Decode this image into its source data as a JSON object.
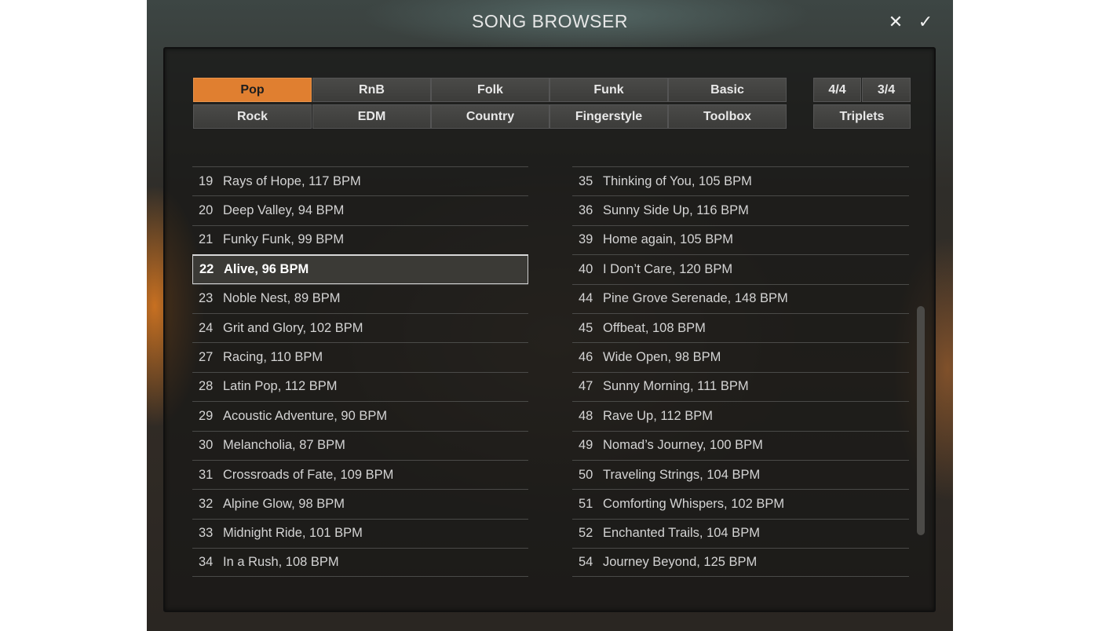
{
  "title": "SONG BROWSER",
  "header": {
    "close_label": "✕",
    "confirm_label": "✓"
  },
  "styles": [
    "Pop",
    "RnB",
    "Folk",
    "Funk",
    "Basic",
    "Rock",
    "EDM",
    "Country",
    "Fingerstyle",
    "Toolbox"
  ],
  "active_style": "Pop",
  "meters": [
    "4/4",
    "3/4",
    "Triplets"
  ],
  "songs_left": [
    {
      "num": "19",
      "name": "Rays of Hope, 117 BPM"
    },
    {
      "num": "20",
      "name": "Deep Valley, 94 BPM"
    },
    {
      "num": "21",
      "name": "Funky Funk, 99 BPM"
    },
    {
      "num": "22",
      "name": "Alive, 96 BPM"
    },
    {
      "num": "23",
      "name": "Noble Nest, 89 BPM"
    },
    {
      "num": "24",
      "name": "Grit and Glory, 102 BPM"
    },
    {
      "num": "27",
      "name": "Racing, 110 BPM"
    },
    {
      "num": "28",
      "name": "Latin Pop, 112 BPM"
    },
    {
      "num": "29",
      "name": "Acoustic Adventure, 90 BPM"
    },
    {
      "num": "30",
      "name": "Melancholia, 87 BPM"
    },
    {
      "num": "31",
      "name": "Crossroads of Fate, 109 BPM"
    },
    {
      "num": "32",
      "name": "Alpine Glow, 98 BPM"
    },
    {
      "num": "33",
      "name": "Midnight Ride, 101 BPM"
    },
    {
      "num": "34",
      "name": "In a Rush, 108 BPM"
    }
  ],
  "songs_right": [
    {
      "num": "35",
      "name": "Thinking of You, 105 BPM"
    },
    {
      "num": "36",
      "name": "Sunny Side Up, 116 BPM"
    },
    {
      "num": "39",
      "name": "Home again, 105 BPM"
    },
    {
      "num": "40",
      "name": "I Don’t Care, 120 BPM"
    },
    {
      "num": "44",
      "name": "Pine Grove Serenade, 148 BPM"
    },
    {
      "num": "45",
      "name": "Offbeat, 108 BPM"
    },
    {
      "num": "46",
      "name": "Wide Open, 98 BPM"
    },
    {
      "num": "47",
      "name": "Sunny Morning, 111 BPM"
    },
    {
      "num": "48",
      "name": "Rave Up, 112 BPM"
    },
    {
      "num": "49",
      "name": "Nomad’s Journey, 100 BPM"
    },
    {
      "num": "50",
      "name": "Traveling Strings, 104 BPM"
    },
    {
      "num": "51",
      "name": "Comforting Whispers, 102 BPM"
    },
    {
      "num": "52",
      "name": "Enchanted Trails, 104 BPM"
    },
    {
      "num": "54",
      "name": "Journey Beyond, 125 BPM"
    }
  ],
  "selected_song": "22",
  "colors": {
    "accent": "#e07f30",
    "panel": "#181816",
    "text": "#d4d4d4"
  }
}
